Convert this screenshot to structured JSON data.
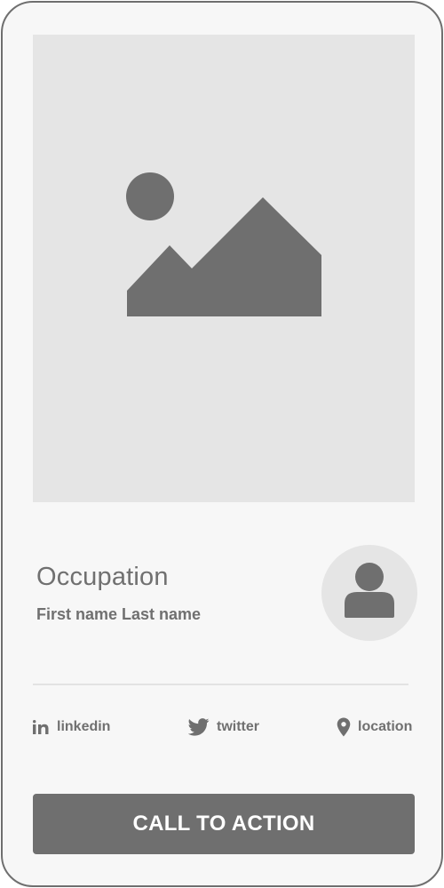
{
  "profile": {
    "occupation": "Occupation",
    "full_name": "First name Last name"
  },
  "social": {
    "linkedin": {
      "label": "linkedin",
      "icon": "linkedin-icon"
    },
    "twitter": {
      "label": "twitter",
      "icon": "twitter-bird-icon"
    },
    "location": {
      "label": "location",
      "icon": "map-pin-icon"
    }
  },
  "cta": {
    "label": "CALL TO ACTION"
  },
  "colors": {
    "card_background": "#f7f7f7",
    "card_border": "#6f6f6f",
    "placeholder_fill": "#e5e5e5",
    "icon_fill": "#6f6f6f",
    "text": "#707070",
    "cta_background": "#6f6f6f",
    "cta_text": "#ffffff"
  }
}
